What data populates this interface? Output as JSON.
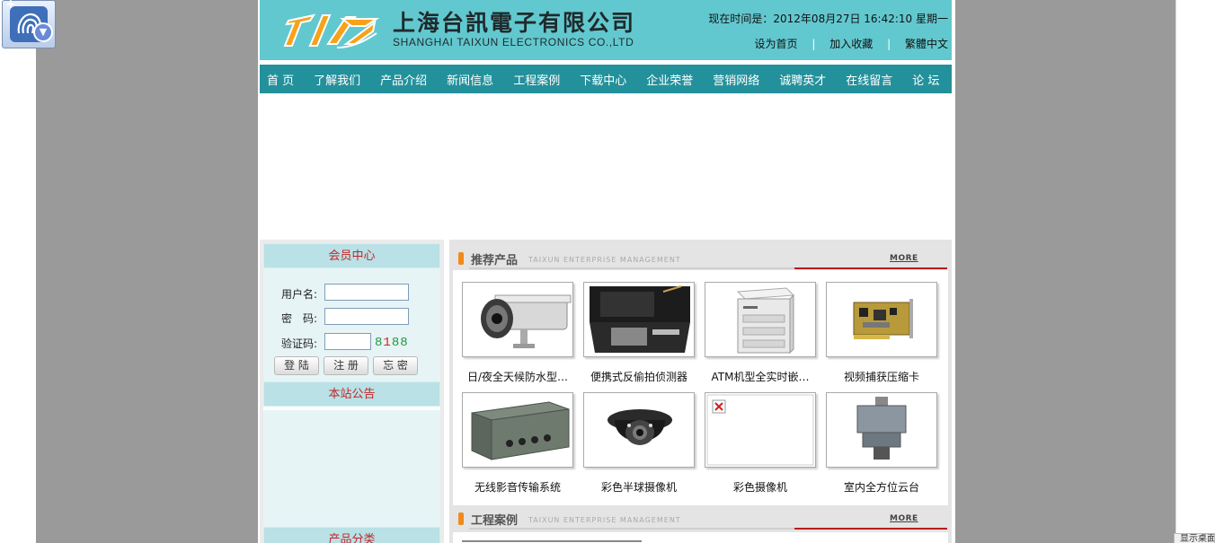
{
  "desktop": {
    "corner_label": "显示桌面"
  },
  "header": {
    "company_cn": "上海台訊電子有限公司",
    "company_en": "SHANGHAI TAIXUN ELECTRONICS CO.,LTD",
    "time_label": "现在时间是：",
    "time_value": "2012年08月27日 16:42:10 星期一",
    "links": [
      "设为首页",
      "加入收藏",
      "繁體中文"
    ],
    "link_separator": "|"
  },
  "nav": [
    "首 页",
    "了解我们",
    "产品介绍",
    "新闻信息",
    "工程案例",
    "下载中心",
    "企业荣誉",
    "营销网络",
    "诚聘英才",
    "在线留言",
    "论 坛"
  ],
  "sidebar": {
    "member_title": "会员中心",
    "username_label": "用户名:",
    "password_label": "密　码:",
    "captcha_label": "验证码:",
    "captcha_digits": [
      "8",
      "1",
      "8",
      "8"
    ],
    "buttons": [
      "登 陆",
      "注 册",
      "忘 密"
    ],
    "notice_title": "本站公告",
    "category_title": "产品分类"
  },
  "recommend": {
    "title": "推荐产品",
    "subtitle": "TAIXUN ENTERPRISE MANAGEMENT",
    "more": "MORE",
    "products": [
      {
        "name": "日/夜全天候防水型…",
        "icon": "bullet-camera"
      },
      {
        "name": "便携式反偷拍侦测器",
        "icon": "detector-case"
      },
      {
        "name": "ATM机型全实时嵌…",
        "icon": "dvr-box"
      },
      {
        "name": "视频捕获压缩卡",
        "icon": "capture-card"
      },
      {
        "name": "无线影音传输系统",
        "icon": "rack-unit"
      },
      {
        "name": "彩色半球摄像机",
        "icon": "dome-camera"
      },
      {
        "name": "彩色摄像机",
        "icon": "broken-image"
      },
      {
        "name": "室内全方位云台",
        "icon": "pan-tilt"
      }
    ]
  },
  "cases": {
    "title": "工程案例",
    "subtitle": "TAIXUN ENTERPRISE MANAGEMENT",
    "more": "MORE"
  },
  "colors": {
    "header_bg": "#62c8cf",
    "nav_bg": "#23919c",
    "panel_head": "#b9e1e6",
    "panel_body": "#e6f4f6",
    "accent_red": "#c0262a",
    "accent_orange": "#f08a1c"
  }
}
